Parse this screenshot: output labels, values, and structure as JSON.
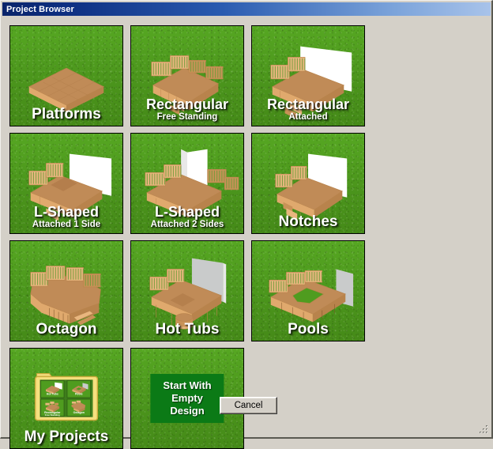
{
  "window": {
    "title": "Project Browser",
    "titlebar_color_left": "#0a246a",
    "titlebar_color_right": "#a8c3ea",
    "background_color": "#d4d0c8"
  },
  "grid": {
    "tiles": [
      {
        "id": "platforms",
        "label": "Platforms",
        "sublabel": "",
        "art": "platform"
      },
      {
        "id": "rectangular-free",
        "label": "Rectangular",
        "sublabel": "Free Standing",
        "art": "rect-free"
      },
      {
        "id": "rectangular-attached",
        "label": "Rectangular",
        "sublabel": "Attached",
        "art": "rect-attached"
      },
      {
        "id": "l-shaped-1-side",
        "label": "L-Shaped",
        "sublabel": "Attached 1 Side",
        "art": "l-one"
      },
      {
        "id": "l-shaped-2-sides",
        "label": "L-Shaped",
        "sublabel": "Attached 2 Sides",
        "art": "l-two"
      },
      {
        "id": "notches",
        "label": "Notches",
        "sublabel": "",
        "art": "notches"
      },
      {
        "id": "octagon",
        "label": "Octagon",
        "sublabel": "",
        "art": "octagon"
      },
      {
        "id": "hot-tubs",
        "label": "Hot Tubs",
        "sublabel": "",
        "art": "hot-tub"
      },
      {
        "id": "pools",
        "label": "Pools",
        "sublabel": "",
        "art": "pool"
      },
      {
        "id": "my-projects",
        "label": "My Projects",
        "sublabel": "",
        "art": "folder"
      }
    ],
    "empty_tile": {
      "id": "start-with-empty-design",
      "line1": "Start With",
      "line2": "Empty",
      "line3": "Design",
      "box_color": "#0b7a16"
    },
    "folder_thumbnails": [
      {
        "label": "Hot Tubs",
        "sublabel": ""
      },
      {
        "label": "Pools",
        "sublabel": ""
      },
      {
        "label": "Rectangular",
        "sublabel": "Free Standing"
      },
      {
        "label": "Octagon",
        "sublabel": ""
      }
    ]
  },
  "footer": {
    "cancel_label": "Cancel"
  }
}
